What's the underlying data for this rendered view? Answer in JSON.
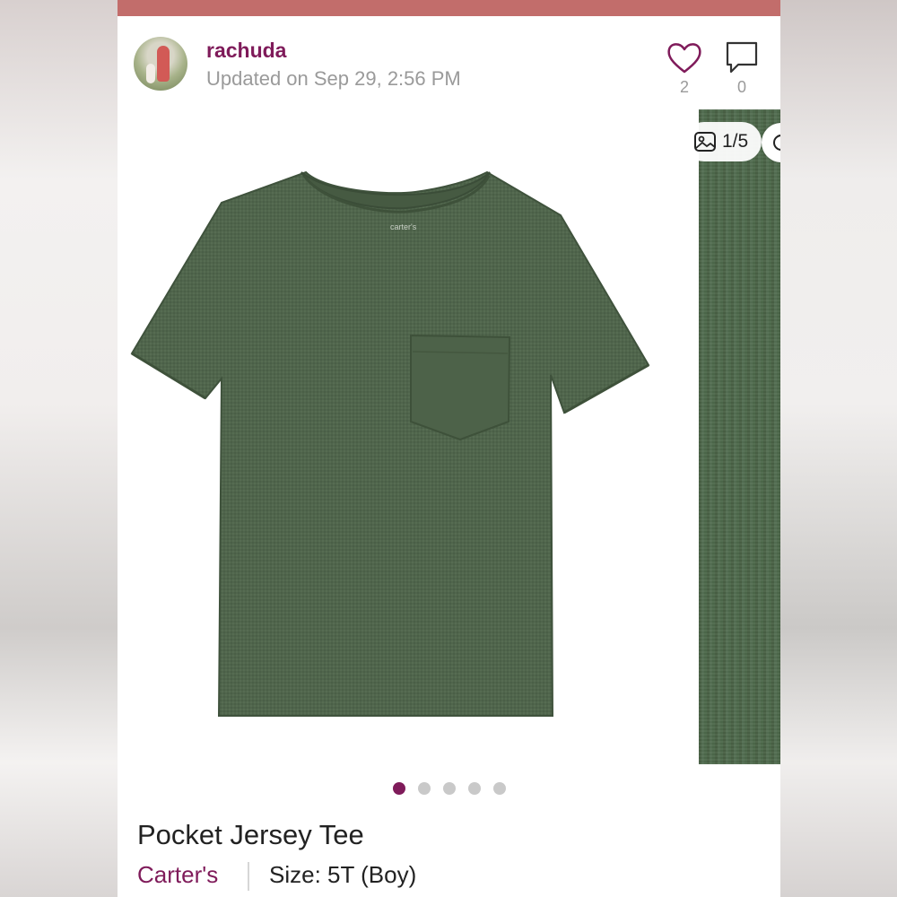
{
  "header": {
    "username": "rachuda",
    "updated": "Updated on Sep 29, 2:56 PM",
    "likes": "2",
    "comments": "0"
  },
  "gallery": {
    "counter": "1/5",
    "shirt_label": "carter's",
    "dots": 5,
    "active_dot": 1
  },
  "listing": {
    "title": "Pocket Jersey Tee",
    "brand": "Carter's",
    "size": "Size: 5T (Boy)"
  },
  "colors": {
    "accent": "#7f1b5a",
    "top_bar": "#c26d6b",
    "shirt": "#50654c"
  },
  "icons": {
    "like": "heart-icon",
    "comment": "comment-icon",
    "gallery": "image-icon",
    "action": "circle-icon"
  }
}
